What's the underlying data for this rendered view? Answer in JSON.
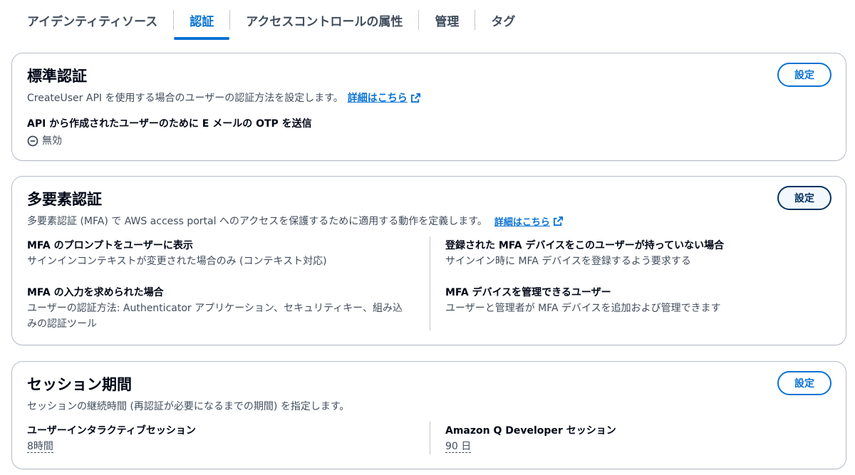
{
  "tabs": [
    {
      "label": "アイデンティティソース",
      "active": false
    },
    {
      "label": "認証",
      "active": true
    },
    {
      "label": "アクセスコントロールの属性",
      "active": false
    },
    {
      "label": "管理",
      "active": false
    },
    {
      "label": "タグ",
      "active": false
    }
  ],
  "standard_auth": {
    "title": "標準認証",
    "description": "CreateUser API を使用する場合のユーザーの認証方法を設定します。",
    "link": "詳細はこちら",
    "setting_label": "API から作成されたユーザーのために E メールの OTP を送信",
    "setting_value": "無効",
    "button": "設定"
  },
  "mfa": {
    "title": "多要素認証",
    "description": "多要素認証 (MFA) で AWS access portal へのアクセスを保護するために適用する動作を定義します。",
    "link": "詳細はこちら",
    "button": "設定",
    "items": [
      {
        "label": "MFA のプロンプトをユーザーに表示",
        "value": "サインインコンテキストが変更された場合のみ (コンテキスト対応)"
      },
      {
        "label": "MFA の入力を求められた場合",
        "value": "ユーザーの認証方法: Authenticator アプリケーション、セキュリティキー、組み込みの認証ツール"
      },
      {
        "label": "登録された MFA デバイスをこのユーザーが持っていない場合",
        "value": "サインイン時に MFA デバイスを登録するよう要求する"
      },
      {
        "label": "MFA デバイスを管理できるユーザー",
        "value": "ユーザーと管理者が MFA デバイスを追加および管理できます"
      }
    ]
  },
  "session": {
    "title": "セッション期間",
    "description": "セッションの継続時間 (再認証が必要になるまでの期間) を指定します。",
    "button": "設定",
    "items": [
      {
        "label": "ユーザーインタラクティブセッション",
        "value": "8時間"
      },
      {
        "label": "Amazon Q Developer セッション",
        "value": "90 日"
      }
    ]
  },
  "colors": {
    "accent": "#0972d3",
    "text": "#000716",
    "secondary_text": "#414d5c",
    "border": "#b6bec9"
  }
}
